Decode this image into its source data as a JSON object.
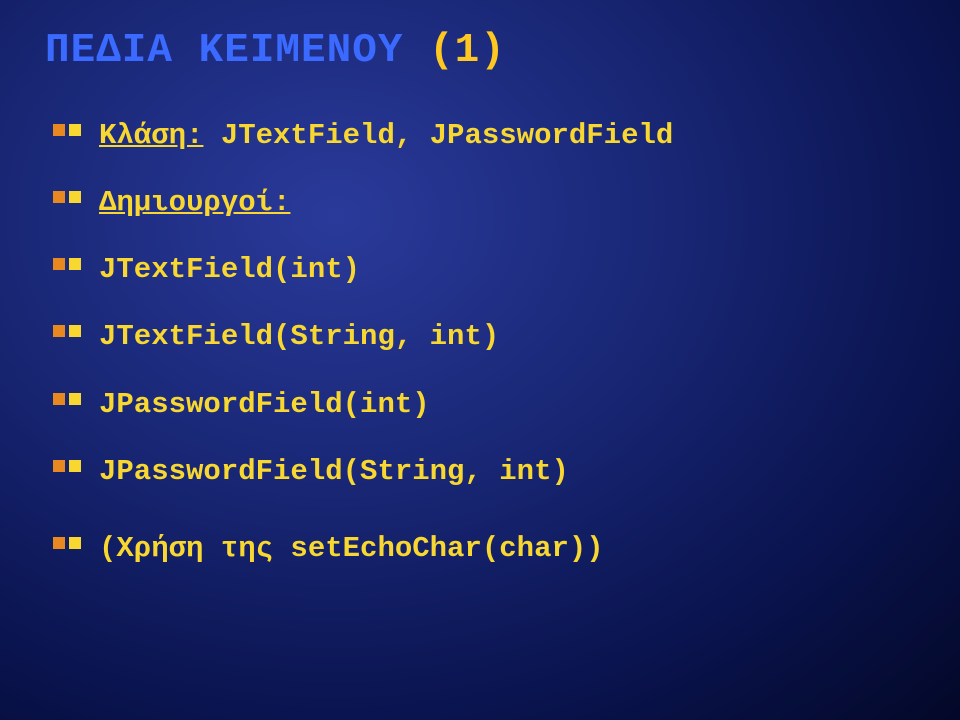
{
  "title": {
    "part1": "ΠΕΔΙΑ ΚΕΙΜΕΝΟΥ",
    "part2": "(1)"
  },
  "lines": {
    "l0_label": "Κλάση:",
    "l0_rest": " JTextField, JPasswordField",
    "l1_label": "Δημιουργοί:",
    "l2": "JTextField(int)",
    "l3": "JTextField(String, int)",
    "l4": "JPasswordField(int)",
    "l5": "JPasswordField(String, int)",
    "l6": "(Χρήση της setEchoChar(char))"
  }
}
